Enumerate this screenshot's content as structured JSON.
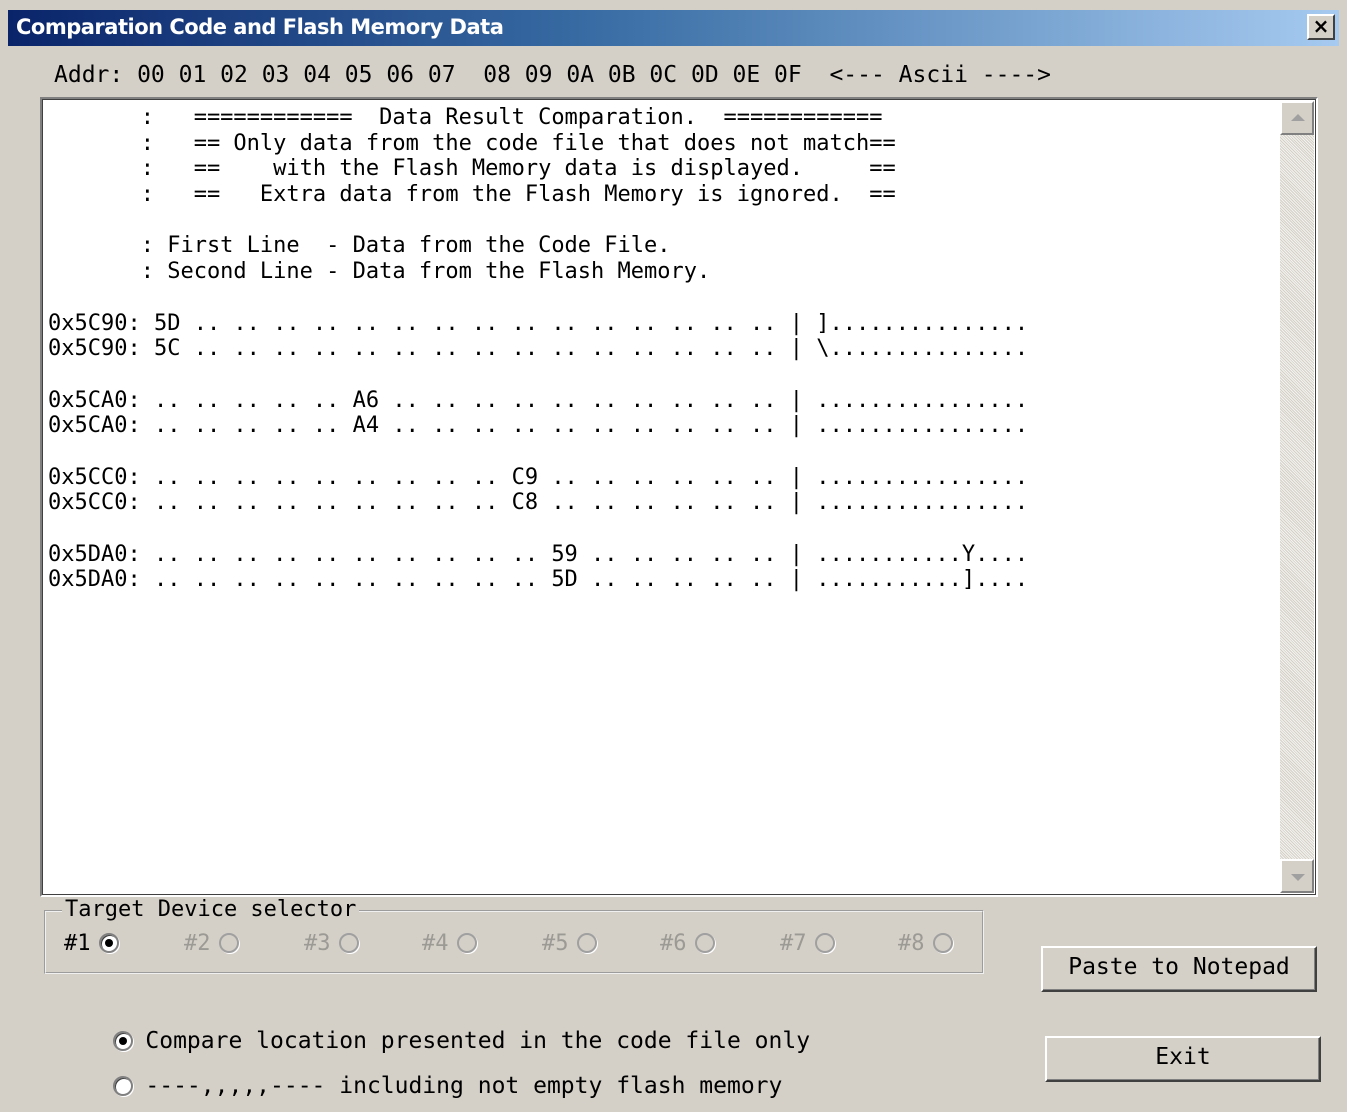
{
  "window": {
    "title": "Comparation Code and Flash Memory Data",
    "close_glyph": "×"
  },
  "header": {
    "columns": "Addr: 00 01 02 03 04 05 06 07  08 09 0A 0B 0C 0D 0E 0F  <--- Ascii ---->"
  },
  "result_text": {
    "lines": [
      "       :   ============  Data Result Comparation.  ============",
      "       :   == Only data from the code file that does not match==",
      "       :   ==    with the Flash Memory data is displayed.     ==",
      "       :   ==   Extra data from the Flash Memory is ignored.  ==",
      "",
      "       : First Line  - Data from the Code File.",
      "       : Second Line - Data from the Flash Memory.",
      "",
      "0x5C90: 5D .. .. .. .. .. .. .. .. .. .. .. .. .. .. .. | ]...............",
      "0x5C90: 5C .. .. .. .. .. .. .. .. .. .. .. .. .. .. .. | \\...............",
      "",
      "0x5CA0: .. .. .. .. .. A6 .. .. .. .. .. .. .. .. .. .. | ................",
      "0x5CA0: .. .. .. .. .. A4 .. .. .. .. .. .. .. .. .. .. | ................",
      "",
      "0x5CC0: .. .. .. .. .. .. .. .. .. C9 .. .. .. .. .. .. | ................",
      "0x5CC0: .. .. .. .. .. .. .. .. .. C8 .. .. .. .. .. .. | ................",
      "",
      "0x5DA0: .. .. .. .. .. .. .. .. .. .. 59 .. .. .. .. .. | ...........Y....",
      "0x5DA0: .. .. .. .. .. .. .. .. .. .. 5D .. .. .. .. .. | ...........]...."
    ]
  },
  "device_selector": {
    "label": "Target Device selector",
    "devices": [
      {
        "label": "#1",
        "checked": true,
        "enabled": true
      },
      {
        "label": "#2",
        "checked": false,
        "enabled": false
      },
      {
        "label": "#3",
        "checked": false,
        "enabled": false
      },
      {
        "label": "#4",
        "checked": false,
        "enabled": false
      },
      {
        "label": "#5",
        "checked": false,
        "enabled": false
      },
      {
        "label": "#6",
        "checked": false,
        "enabled": false
      },
      {
        "label": "#7",
        "checked": false,
        "enabled": false
      },
      {
        "label": "#8",
        "checked": false,
        "enabled": false
      }
    ]
  },
  "compare_options": [
    {
      "label": "Compare location presented in the code file only",
      "checked": true
    },
    {
      "label": "----,,,,,---- including not empty flash memory",
      "checked": false
    }
  ],
  "buttons": {
    "paste": "Paste to Notepad",
    "exit": "Exit"
  }
}
